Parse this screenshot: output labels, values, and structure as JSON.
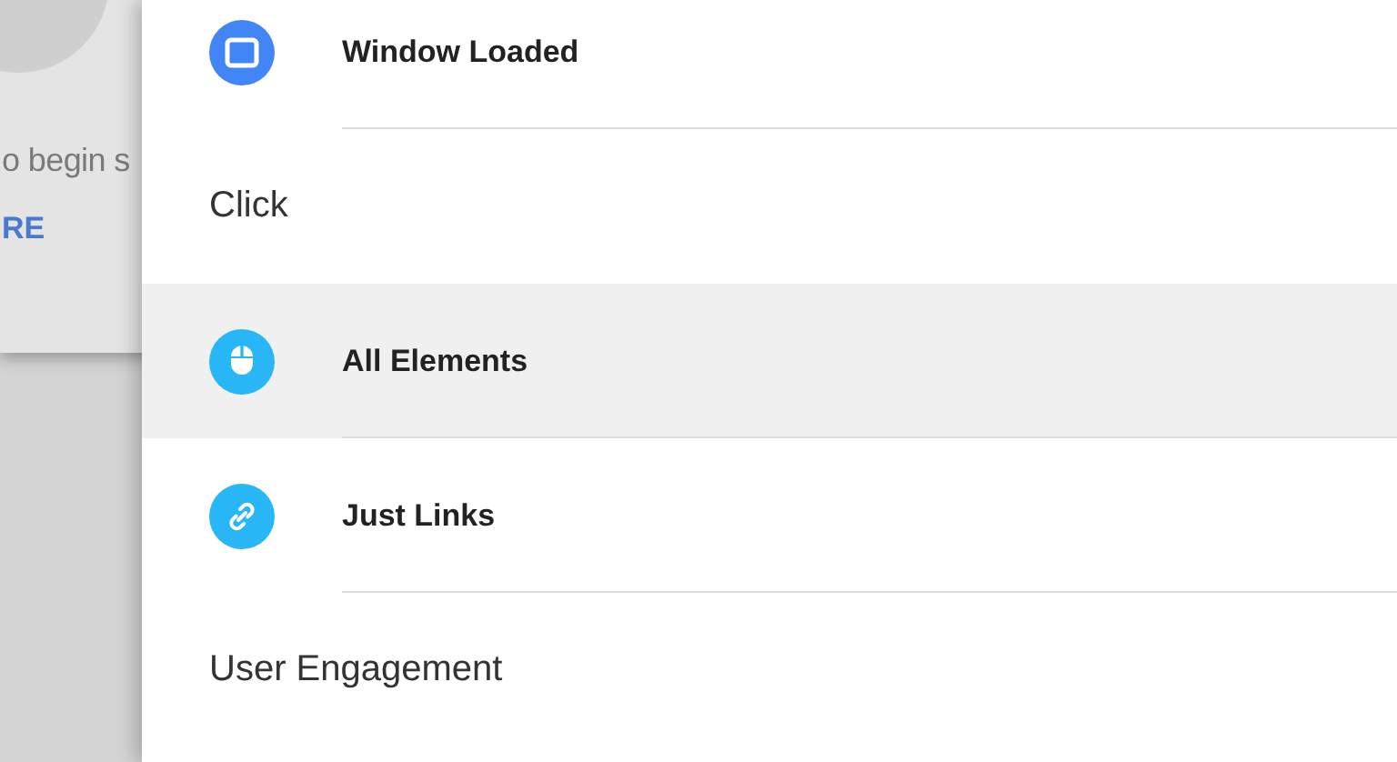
{
  "background_card": {
    "text": "o begin s",
    "link": "RE"
  },
  "trigger_groups": [
    {
      "items": [
        {
          "label": "Window Loaded",
          "kind": "window",
          "selected": false
        }
      ]
    },
    {
      "header": "Click",
      "items": [
        {
          "label": "All Elements",
          "kind": "mouse",
          "selected": true
        },
        {
          "label": "Just Links",
          "kind": "link",
          "selected": false
        }
      ]
    },
    {
      "header": "User Engagement"
    }
  ]
}
